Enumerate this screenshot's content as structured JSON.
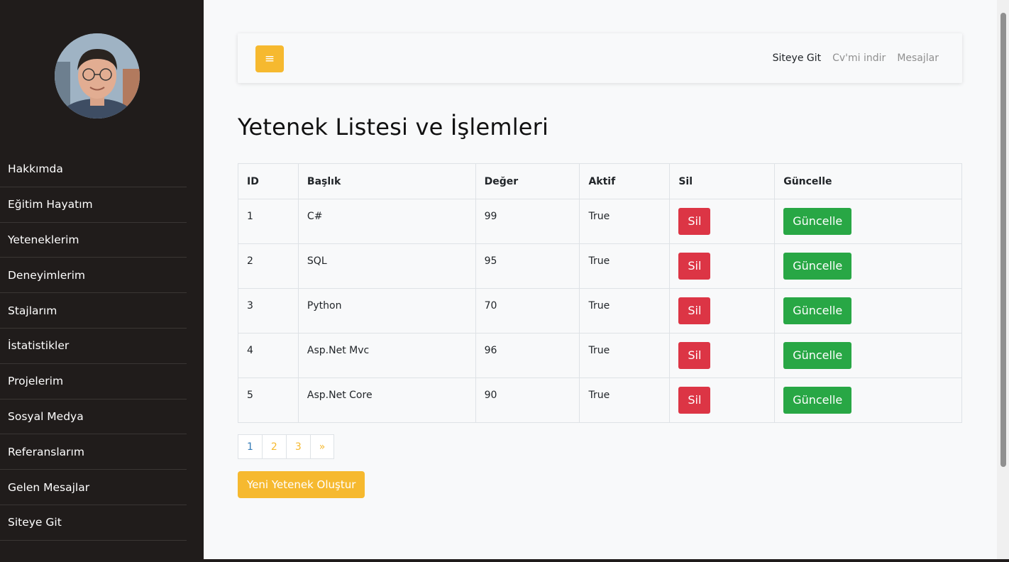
{
  "sidebar": {
    "items": [
      {
        "label": "Hakkımda"
      },
      {
        "label": "Eğitim Hayatım"
      },
      {
        "label": "Yeteneklerim"
      },
      {
        "label": "Deneyimlerim"
      },
      {
        "label": "Stajlarım"
      },
      {
        "label": "İstatistikler"
      },
      {
        "label": "Projelerim"
      },
      {
        "label": "Sosyal Medya"
      },
      {
        "label": "Referanslarım"
      },
      {
        "label": "Gelen Mesajlar"
      },
      {
        "label": "Siteye Git"
      }
    ]
  },
  "navbar": {
    "toggle_icon": "≡",
    "links": [
      {
        "label": "Siteye Git"
      },
      {
        "label": "Cv'mi indir"
      },
      {
        "label": "Mesajlar"
      }
    ]
  },
  "page": {
    "title": "Yetenek Listesi ve İşlemleri"
  },
  "table": {
    "headers": [
      "ID",
      "Başlık",
      "Değer",
      "Aktif",
      "Sil",
      "Güncelle"
    ],
    "rows": [
      {
        "id": "1",
        "title": "C#",
        "value": "99",
        "active": "True",
        "delete": "Sil",
        "update": "Güncelle"
      },
      {
        "id": "2",
        "title": "SQL",
        "value": "95",
        "active": "True",
        "delete": "Sil",
        "update": "Güncelle"
      },
      {
        "id": "3",
        "title": "Python",
        "value": "70",
        "active": "True",
        "delete": "Sil",
        "update": "Güncelle"
      },
      {
        "id": "4",
        "title": "Asp.Net Mvc",
        "value": "96",
        "active": "True",
        "delete": "Sil",
        "update": "Güncelle"
      },
      {
        "id": "5",
        "title": "Asp.Net Core",
        "value": "90",
        "active": "True",
        "delete": "Sil",
        "update": "Güncelle"
      }
    ]
  },
  "pagination": {
    "pages": [
      "1",
      "2",
      "3",
      "»"
    ]
  },
  "actions": {
    "new_label": "Yeni Yetenek Oluştur"
  },
  "colors": {
    "sidebar_bg": "#201c1b",
    "accent": "#f6b92f",
    "danger": "#dc3545",
    "success": "#28a745"
  }
}
